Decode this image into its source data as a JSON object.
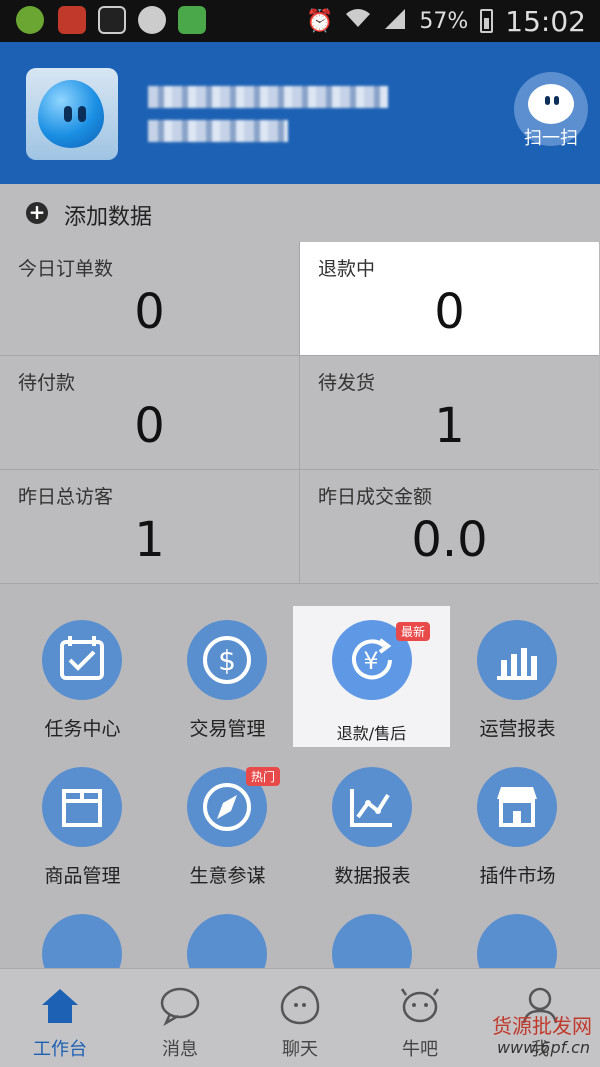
{
  "status_bar": {
    "battery": "57%",
    "time": "15:02"
  },
  "header": {
    "avatar_icon": "wangwang-mascot-icon",
    "scan_label": "扫一扫"
  },
  "add_data": {
    "label": "添加数据"
  },
  "stats": [
    {
      "label": "今日订单数",
      "value": "0"
    },
    {
      "label": "退款中",
      "value": "0"
    },
    {
      "label": "待付款",
      "value": "0"
    },
    {
      "label": "待发货",
      "value": "1"
    },
    {
      "label": "昨日总访客",
      "value": "1"
    },
    {
      "label": "昨日成交金额",
      "value": "0.0"
    }
  ],
  "tools": [
    {
      "label": "任务中心",
      "icon": "calendar-check-icon"
    },
    {
      "label": "交易管理",
      "icon": "dollar-coin-icon"
    },
    {
      "label": "退款/售后",
      "icon": "yuan-refresh-icon",
      "badge": "最新"
    },
    {
      "label": "运营报表",
      "icon": "bar-chart-icon"
    },
    {
      "label": "商品管理",
      "icon": "box-icon"
    },
    {
      "label": "生意参谋",
      "icon": "compass-icon",
      "badge": "热门"
    },
    {
      "label": "数据报表",
      "icon": "line-chart-icon"
    },
    {
      "label": "插件市场",
      "icon": "store-icon"
    }
  ],
  "nav": [
    {
      "label": "工作台",
      "icon": "home-icon"
    },
    {
      "label": "消息",
      "icon": "chat-bubble-icon"
    },
    {
      "label": "聊天",
      "icon": "wangwang-icon"
    },
    {
      "label": "牛吧",
      "icon": "cow-icon"
    },
    {
      "label": "我",
      "icon": "person-icon"
    }
  ],
  "watermark": {
    "text": "货源批发网",
    "url": "www.6pf.cn"
  },
  "colors": {
    "header": "#1d61b4",
    "tile_icon": "#5a8fcf",
    "badge": "#e84a4a"
  }
}
